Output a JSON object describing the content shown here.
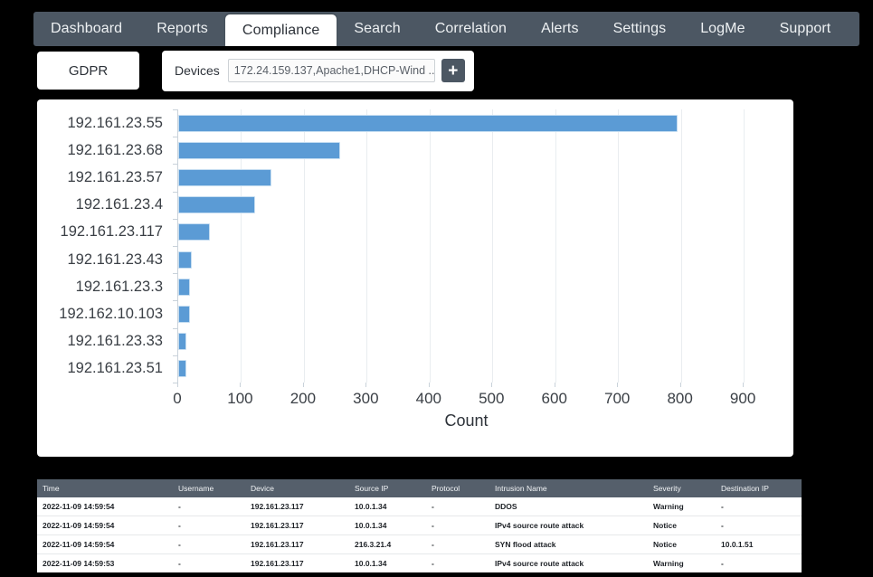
{
  "nav": {
    "items": [
      {
        "label": "Dashboard",
        "active": false
      },
      {
        "label": "Reports",
        "active": false
      },
      {
        "label": "Compliance",
        "active": true
      },
      {
        "label": "Search",
        "active": false
      },
      {
        "label": "Correlation",
        "active": false
      },
      {
        "label": "Alerts",
        "active": false
      },
      {
        "label": "Settings",
        "active": false
      },
      {
        "label": "LogMe",
        "active": false
      },
      {
        "label": "Support",
        "active": false
      }
    ]
  },
  "subbar": {
    "gdpr_label": "GDPR",
    "devices_label": "Devices",
    "devices_value": "172.24.159.137,Apache1,DHCP-Wind  ...",
    "add_button_label": "+"
  },
  "chart_data": {
    "type": "bar",
    "orientation": "horizontal",
    "title": "",
    "xlabel": "Count",
    "ylabel": "",
    "xlim": [
      0,
      920
    ],
    "xticks": [
      0,
      100,
      200,
      300,
      400,
      500,
      600,
      700,
      800,
      900
    ],
    "grid": true,
    "legend": null,
    "bar_color": "#5b9bd5",
    "bar_border_color": "#c5ddf1",
    "categories": [
      "192.161.23.55",
      "192.161.23.68",
      "192.161.23.57",
      "192.161.23.4",
      "192.161.23.117",
      "192.161.23.43",
      "192.161.23.3",
      "192.162.10.103",
      "192.161.23.33",
      "192.161.23.51"
    ],
    "values": [
      795,
      258,
      148,
      122,
      50,
      22,
      18,
      18,
      13,
      13
    ]
  },
  "table": {
    "columns": [
      "Time",
      "Username",
      "Device",
      "Source IP",
      "Protocol",
      "Intrusion Name",
      "Severity",
      "Destination IP"
    ],
    "rows": [
      {
        "time": "2022-11-09 14:59:54",
        "username": "-",
        "device": "192.161.23.117",
        "source_ip": "10.0.1.34",
        "protocol": "-",
        "intrusion_name": "DDOS",
        "severity": "Warning",
        "destination_ip": "-"
      },
      {
        "time": "2022-11-09 14:59:54",
        "username": "-",
        "device": "192.161.23.117",
        "source_ip": "10.0.1.34",
        "protocol": "-",
        "intrusion_name": "IPv4 source route attack",
        "severity": "Notice",
        "destination_ip": "-"
      },
      {
        "time": "2022-11-09 14:59:54",
        "username": "-",
        "device": "192.161.23.117",
        "source_ip": "216.3.21.4",
        "protocol": "-",
        "intrusion_name": "SYN flood attack",
        "severity": "Notice",
        "destination_ip": "10.0.1.51"
      },
      {
        "time": "2022-11-09 14:59:53",
        "username": "-",
        "device": "192.161.23.117",
        "source_ip": "10.0.1.34",
        "protocol": "-",
        "intrusion_name": "IPv4 source route attack",
        "severity": "Warning",
        "destination_ip": "-"
      }
    ]
  }
}
